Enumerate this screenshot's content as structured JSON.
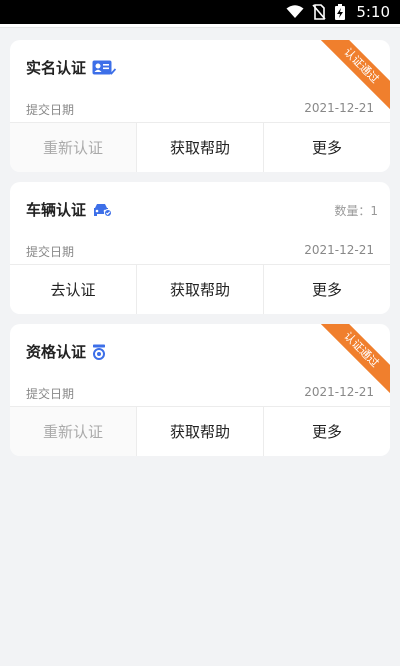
{
  "status_bar": {
    "time": "5:10",
    "icons": [
      "wifi-icon",
      "no-sim-icon",
      "battery-charging-icon"
    ]
  },
  "cards": [
    {
      "title": "实名认证",
      "icon": "id-card-icon",
      "ribbon": "认证通过",
      "date_label": "提交日期",
      "date": "2021-12-21",
      "actions": [
        "重新认证",
        "获取帮助",
        "更多"
      ]
    },
    {
      "title": "车辆认证",
      "icon": "car-icon",
      "qty_text": "数量：1",
      "date_label": "提交日期",
      "date": "2021-12-21",
      "actions": [
        "去认证",
        "获取帮助",
        "更多"
      ]
    },
    {
      "title": "资格认证",
      "icon": "badge-icon",
      "ribbon": "认证通过",
      "date_label": "提交日期",
      "date": "2021-12-21",
      "actions": [
        "重新认证",
        "获取帮助",
        "更多"
      ]
    }
  ],
  "colors": {
    "accent_icon": "#3d6fe8",
    "ribbon": "#f07f2d",
    "background": "#f2f3f5"
  }
}
